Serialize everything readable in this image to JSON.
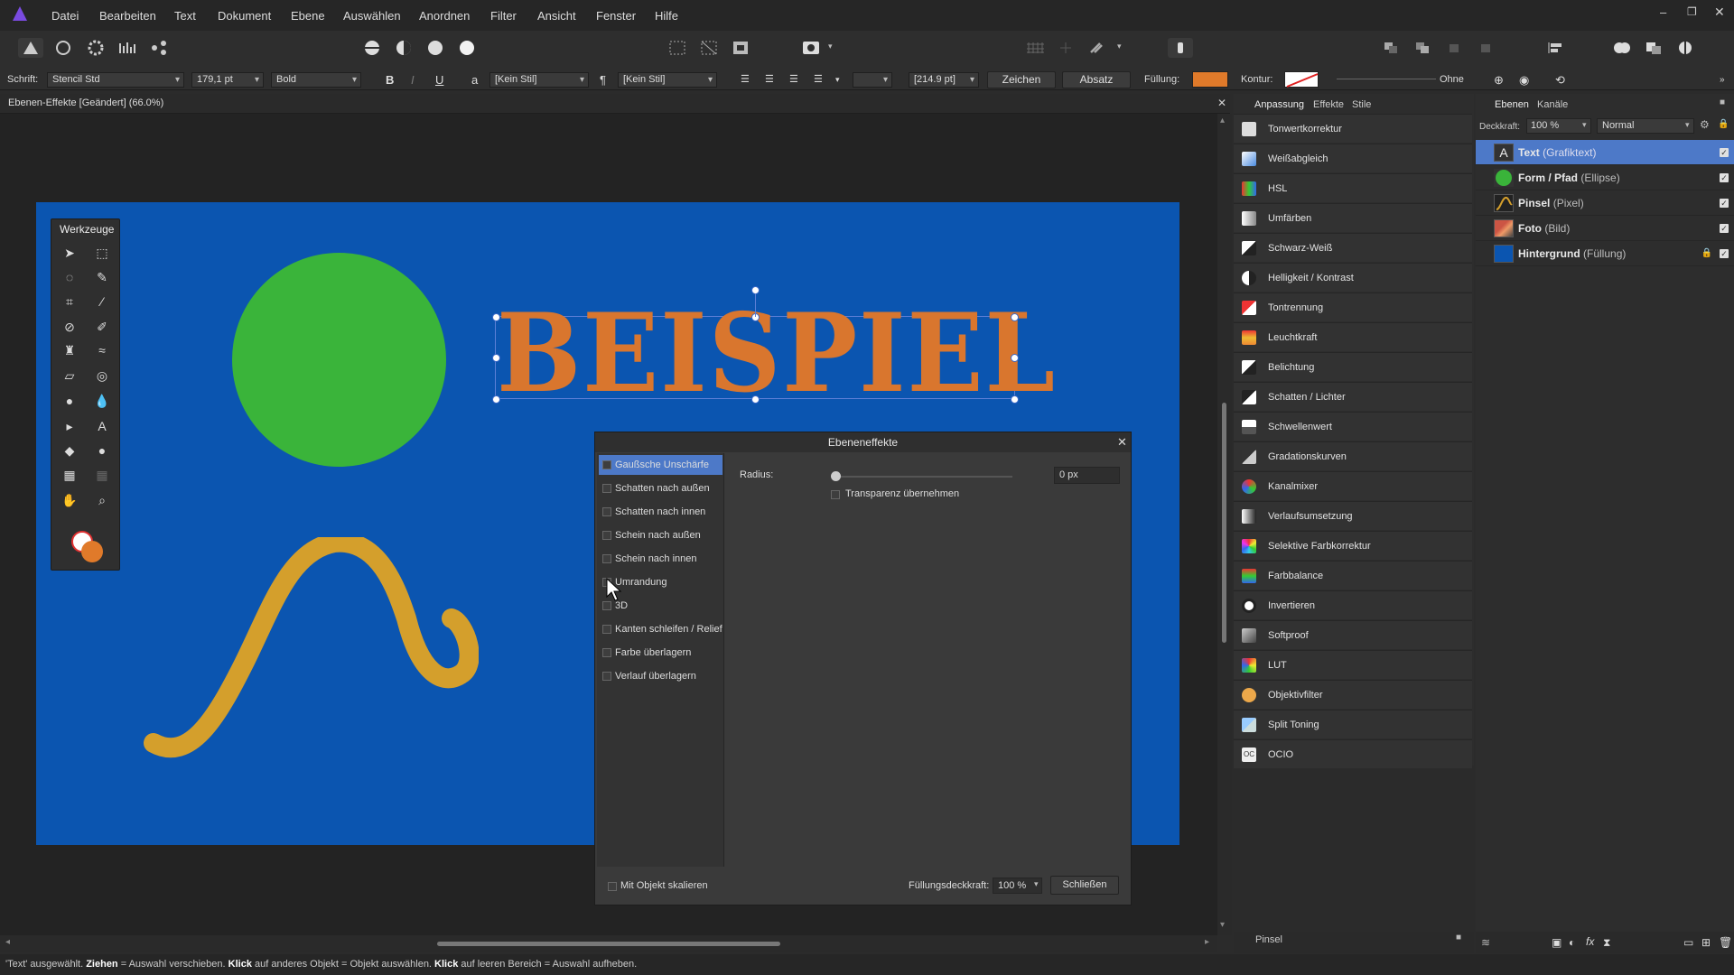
{
  "menu": {
    "items": [
      "Datei",
      "Bearbeiten",
      "Text",
      "Dokument",
      "Ebene",
      "Auswählen",
      "Anordnen",
      "Filter",
      "Ansicht",
      "Fenster",
      "Hilfe"
    ]
  },
  "context": {
    "font_label": "Schrift:",
    "font": "Stencil Std",
    "size": "179,1 pt",
    "style": "Bold",
    "bold": "B",
    "italic": "I",
    "underline": "U",
    "a": "a",
    "char_style": "[Kein Stil]",
    "para_mark": "¶",
    "para_style": "[Kein Stil]",
    "spacing": "[214.9 pt]",
    "zeichen": "Zeichen",
    "absatz": "Absatz",
    "fill_label": "Füllung:",
    "stroke_label": "Kontur:",
    "stroke_value": "Ohne",
    "fill_color": "#e07a2a"
  },
  "doc": {
    "tab_title": "Ebenen-Effekte [Geändert] (66.0%)"
  },
  "canvas": {
    "text": "BEISPIEL",
    "text_color": "#d9762e",
    "circle_color": "#3ab43a",
    "stroke_color": "#d49f2c"
  },
  "tools": {
    "title": "Werkzeuge"
  },
  "dialog": {
    "title": "Ebeneneffekte",
    "effects": [
      "Gaußsche Unschärfe",
      "Schatten nach außen",
      "Schatten nach innen",
      "Schein nach außen",
      "Schein nach innen",
      "Umrandung",
      "3D",
      "Kanten schleifen / Relief",
      "Farbe überlagern",
      "Verlauf überlagern"
    ],
    "radius_label": "Radius:",
    "radius_value": "0 px",
    "transparency": "Transparenz übernehmen",
    "scale_label": "Mit Objekt skalieren",
    "opacity_label": "Füllungsdeckkraft:",
    "opacity_value": "100 %",
    "close": "Schließen"
  },
  "adjust": {
    "tabs": [
      "Anpassung",
      "Effekte",
      "Stile"
    ],
    "items": [
      "Tonwertkorrektur",
      "Weißabgleich",
      "HSL",
      "Umfärben",
      "Schwarz-Weiß",
      "Helligkeit / Kontrast",
      "Tontrennung",
      "Leuchtkraft",
      "Belichtung",
      "Schatten / Lichter",
      "Schwellenwert",
      "Gradationskurven",
      "Kanalmixer",
      "Verlaufsumsetzung",
      "Selektive Farbkorrektur",
      "Farbbalance",
      "Invertieren",
      "Softproof",
      "LUT",
      "Objektivfilter",
      "Split Toning",
      "OCIO"
    ],
    "footer": "Pinsel"
  },
  "layers": {
    "tabs": [
      "Ebenen",
      "Kanäle"
    ],
    "opacity_label": "Deckkraft:",
    "opacity": "100 %",
    "blend": "Normal",
    "items": [
      {
        "name": "Text",
        "type": "(Grafiktext)"
      },
      {
        "name": "Form / Pfad",
        "type": "(Ellipse)"
      },
      {
        "name": "Pinsel",
        "type": "(Pixel)"
      },
      {
        "name": "Foto",
        "type": "(Bild)"
      },
      {
        "name": "Hintergrund",
        "type": "(Füllung)"
      }
    ]
  },
  "status": {
    "p1": "'Text' ausgewählt. ",
    "b1": "Ziehen",
    "p2": " = Auswahl verschieben. ",
    "b2": "Klick",
    "p3": " auf anderes Objekt = Objekt auswählen. ",
    "b3": "Klick",
    "p4": " auf leeren Bereich = Auswahl aufheben."
  }
}
